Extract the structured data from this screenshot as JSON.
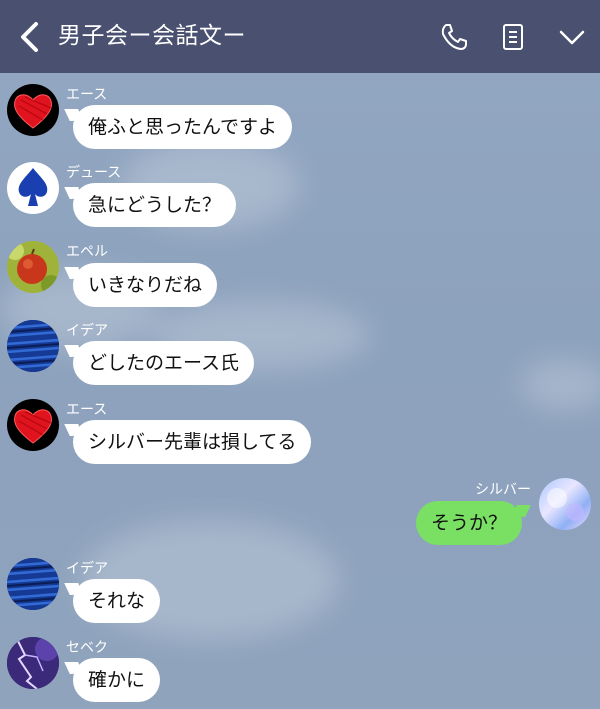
{
  "header": {
    "back_icon": "chevron-left-icon",
    "title": "男子会ー会話文ー",
    "icons": [
      "phone-icon",
      "notes-icon",
      "chevron-down-icon"
    ]
  },
  "messages": [
    {
      "sender": "エース",
      "text": "俺ふと思ったんですよ",
      "avatar": "red-heart"
    },
    {
      "sender": "デュース",
      "text": "急にどうした？",
      "avatar": "blue-spade"
    },
    {
      "sender": "エペル",
      "text": "いきなりだね",
      "avatar": "apple"
    },
    {
      "sender": "イデア",
      "text": "どしたのエース氏",
      "avatar": "blue-texture"
    },
    {
      "sender": "エース",
      "text": "シルバー先輩は損してる",
      "avatar": "red-heart"
    },
    {
      "sender": "シルバー",
      "text": "そうか？",
      "avatar": "iridescent",
      "side": "right"
    },
    {
      "sender": "イデア",
      "text": "それな",
      "avatar": "blue-texture"
    },
    {
      "sender": "セベク",
      "text": "確かに",
      "avatar": "purple-lightning"
    }
  ],
  "colors": {
    "header_bg": "#4a5170",
    "bubble_self": "#7ae064",
    "bubble_other": "#ffffff"
  }
}
